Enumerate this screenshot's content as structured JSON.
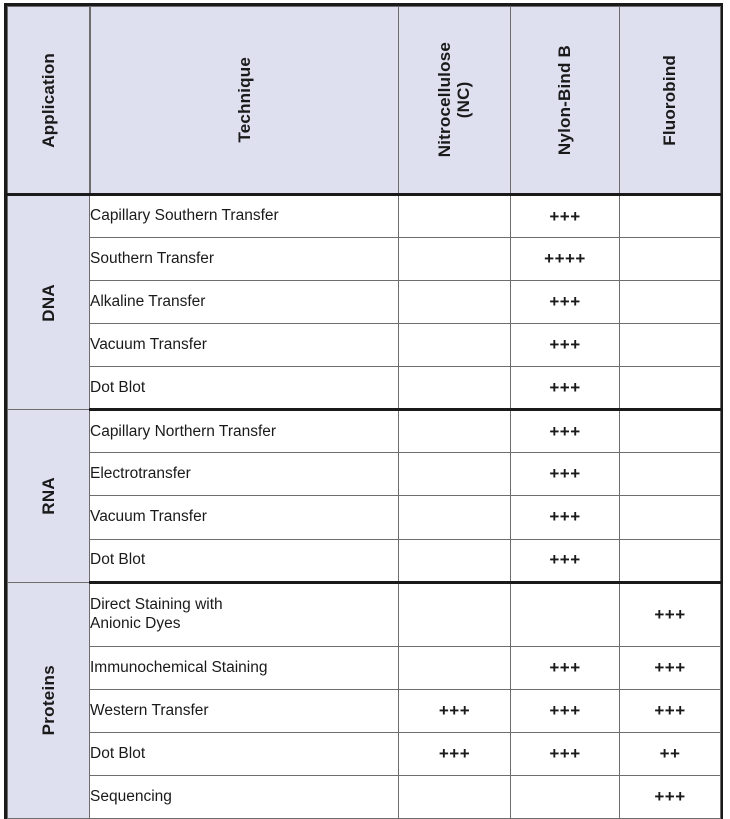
{
  "table": {
    "headers": [
      {
        "id": "application",
        "label": "Application"
      },
      {
        "id": "technique",
        "label": "Technique"
      },
      {
        "id": "nitrocellulose",
        "label": "Nitrocellulose\n(NC)"
      },
      {
        "id": "nylon_bind_b",
        "label": "Nylon-Bind B"
      },
      {
        "id": "fluorobind",
        "label": "Fluorobind"
      }
    ],
    "colors": {
      "header_background": "#DEE0F0",
      "section_label_background": "#DEE0F0",
      "cell_background": "#FFFFFF",
      "border": "#1A1A1A",
      "inner_border": "#6D6D6D",
      "text": "#1A1A1A"
    },
    "sections": [
      {
        "application": "DNA",
        "rows": [
          {
            "technique": "Capillary Southern Transfer",
            "nitrocellulose": "",
            "nylon_bind_b": "+++",
            "fluorobind": ""
          },
          {
            "technique": "Southern Transfer",
            "nitrocellulose": "",
            "nylon_bind_b": "++++",
            "fluorobind": ""
          },
          {
            "technique": "Alkaline Transfer",
            "nitrocellulose": "",
            "nylon_bind_b": "+++",
            "fluorobind": ""
          },
          {
            "technique": "Vacuum Transfer",
            "nitrocellulose": "",
            "nylon_bind_b": "+++",
            "fluorobind": ""
          },
          {
            "technique": "Dot Blot",
            "nitrocellulose": "",
            "nylon_bind_b": "+++",
            "fluorobind": ""
          }
        ]
      },
      {
        "application": "RNA",
        "rows": [
          {
            "technique": "Capillary Northern Transfer",
            "nitrocellulose": "",
            "nylon_bind_b": "+++",
            "fluorobind": ""
          },
          {
            "technique": "Electrotransfer",
            "nitrocellulose": "",
            "nylon_bind_b": "+++",
            "fluorobind": ""
          },
          {
            "technique": "Vacuum Transfer",
            "nitrocellulose": "",
            "nylon_bind_b": "+++",
            "fluorobind": ""
          },
          {
            "technique": "Dot Blot",
            "nitrocellulose": "",
            "nylon_bind_b": "+++",
            "fluorobind": ""
          }
        ]
      },
      {
        "application": "Proteins",
        "rows": [
          {
            "technique": "Direct Staining with\nAnionic Dyes",
            "nitrocellulose": "",
            "nylon_bind_b": "",
            "fluorobind": "+++",
            "tall": true
          },
          {
            "technique": "Immunochemical Staining",
            "nitrocellulose": "",
            "nylon_bind_b": "+++",
            "fluorobind": "+++"
          },
          {
            "technique": "Western Transfer",
            "nitrocellulose": "+++",
            "nylon_bind_b": "+++",
            "fluorobind": "+++"
          },
          {
            "technique": "Dot Blot",
            "nitrocellulose": "+++",
            "nylon_bind_b": "+++",
            "fluorobind": "++"
          },
          {
            "technique": "Sequencing",
            "nitrocellulose": "",
            "nylon_bind_b": "",
            "fluorobind": "+++"
          }
        ]
      }
    ]
  }
}
